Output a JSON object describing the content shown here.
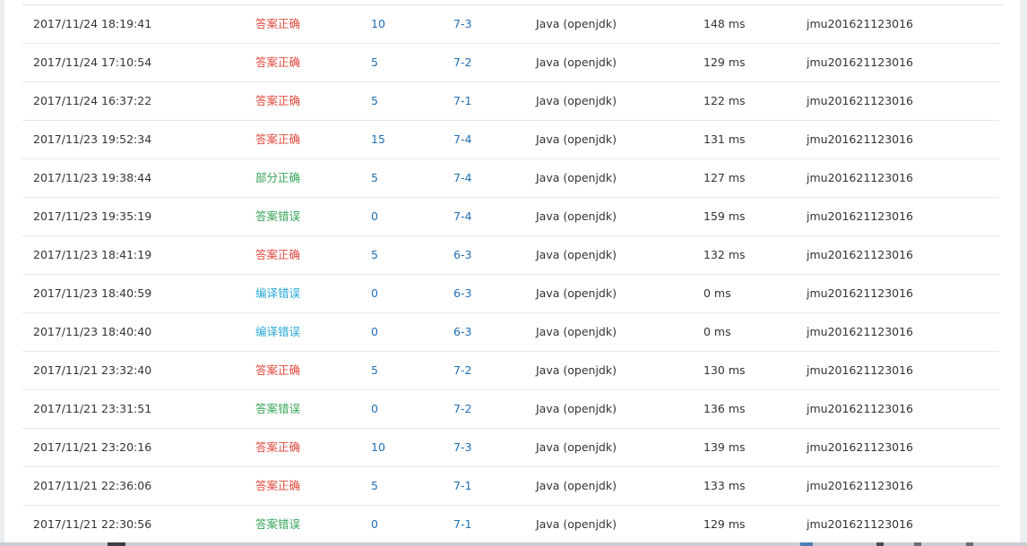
{
  "submissions": [
    {
      "time": "2017/11/24 18:19:41",
      "status": "答案正确",
      "status_type": "ac",
      "score": "10",
      "problem": "7-3",
      "compiler": "Java (openjdk)",
      "time_cost": "148 ms",
      "user": "jmu201621123016"
    },
    {
      "time": "2017/11/24 17:10:54",
      "status": "答案正确",
      "status_type": "ac",
      "score": "5",
      "problem": "7-2",
      "compiler": "Java (openjdk)",
      "time_cost": "129 ms",
      "user": "jmu201621123016"
    },
    {
      "time": "2017/11/24 16:37:22",
      "status": "答案正确",
      "status_type": "ac",
      "score": "5",
      "problem": "7-1",
      "compiler": "Java (openjdk)",
      "time_cost": "122 ms",
      "user": "jmu201621123016"
    },
    {
      "time": "2017/11/23 19:52:34",
      "status": "答案正确",
      "status_type": "ac",
      "score": "15",
      "problem": "7-4",
      "compiler": "Java (openjdk)",
      "time_cost": "131 ms",
      "user": "jmu201621123016"
    },
    {
      "time": "2017/11/23 19:38:44",
      "status": "部分正确",
      "status_type": "pa",
      "score": "5",
      "problem": "7-4",
      "compiler": "Java (openjdk)",
      "time_cost": "127 ms",
      "user": "jmu201621123016"
    },
    {
      "time": "2017/11/23 19:35:19",
      "status": "答案错误",
      "status_type": "wa",
      "score": "0",
      "problem": "7-4",
      "compiler": "Java (openjdk)",
      "time_cost": "159 ms",
      "user": "jmu201621123016"
    },
    {
      "time": "2017/11/23 18:41:19",
      "status": "答案正确",
      "status_type": "ac",
      "score": "5",
      "problem": "6-3",
      "compiler": "Java (openjdk)",
      "time_cost": "132 ms",
      "user": "jmu201621123016"
    },
    {
      "time": "2017/11/23 18:40:59",
      "status": "编译错误",
      "status_type": "ce",
      "score": "0",
      "problem": "6-3",
      "compiler": "Java (openjdk)",
      "time_cost": "0 ms",
      "user": "jmu201621123016"
    },
    {
      "time": "2017/11/23 18:40:40",
      "status": "编译错误",
      "status_type": "ce",
      "score": "0",
      "problem": "6-3",
      "compiler": "Java (openjdk)",
      "time_cost": "0 ms",
      "user": "jmu201621123016"
    },
    {
      "time": "2017/11/21 23:32:40",
      "status": "答案正确",
      "status_type": "ac",
      "score": "5",
      "problem": "7-2",
      "compiler": "Java (openjdk)",
      "time_cost": "130 ms",
      "user": "jmu201621123016"
    },
    {
      "time": "2017/11/21 23:31:51",
      "status": "答案错误",
      "status_type": "wa",
      "score": "0",
      "problem": "7-2",
      "compiler": "Java (openjdk)",
      "time_cost": "136 ms",
      "user": "jmu201621123016"
    },
    {
      "time": "2017/11/21 23:20:16",
      "status": "答案正确",
      "status_type": "ac",
      "score": "10",
      "problem": "7-3",
      "compiler": "Java (openjdk)",
      "time_cost": "139 ms",
      "user": "jmu201621123016"
    },
    {
      "time": "2017/11/21 22:36:06",
      "status": "答案正确",
      "status_type": "ac",
      "score": "5",
      "problem": "7-1",
      "compiler": "Java (openjdk)",
      "time_cost": "133 ms",
      "user": "jmu201621123016"
    },
    {
      "time": "2017/11/21 22:30:56",
      "status": "答案错误",
      "status_type": "wa",
      "score": "0",
      "problem": "7-1",
      "compiler": "Java (openjdk)",
      "time_cost": "129 ms",
      "user": "jmu201621123016"
    }
  ],
  "colors": {
    "accepted": "#e04b3f",
    "partial": "#3aa55a",
    "wrong": "#3aa55a",
    "compile_error": "#27a8d8",
    "link": "#1f6fb5"
  }
}
